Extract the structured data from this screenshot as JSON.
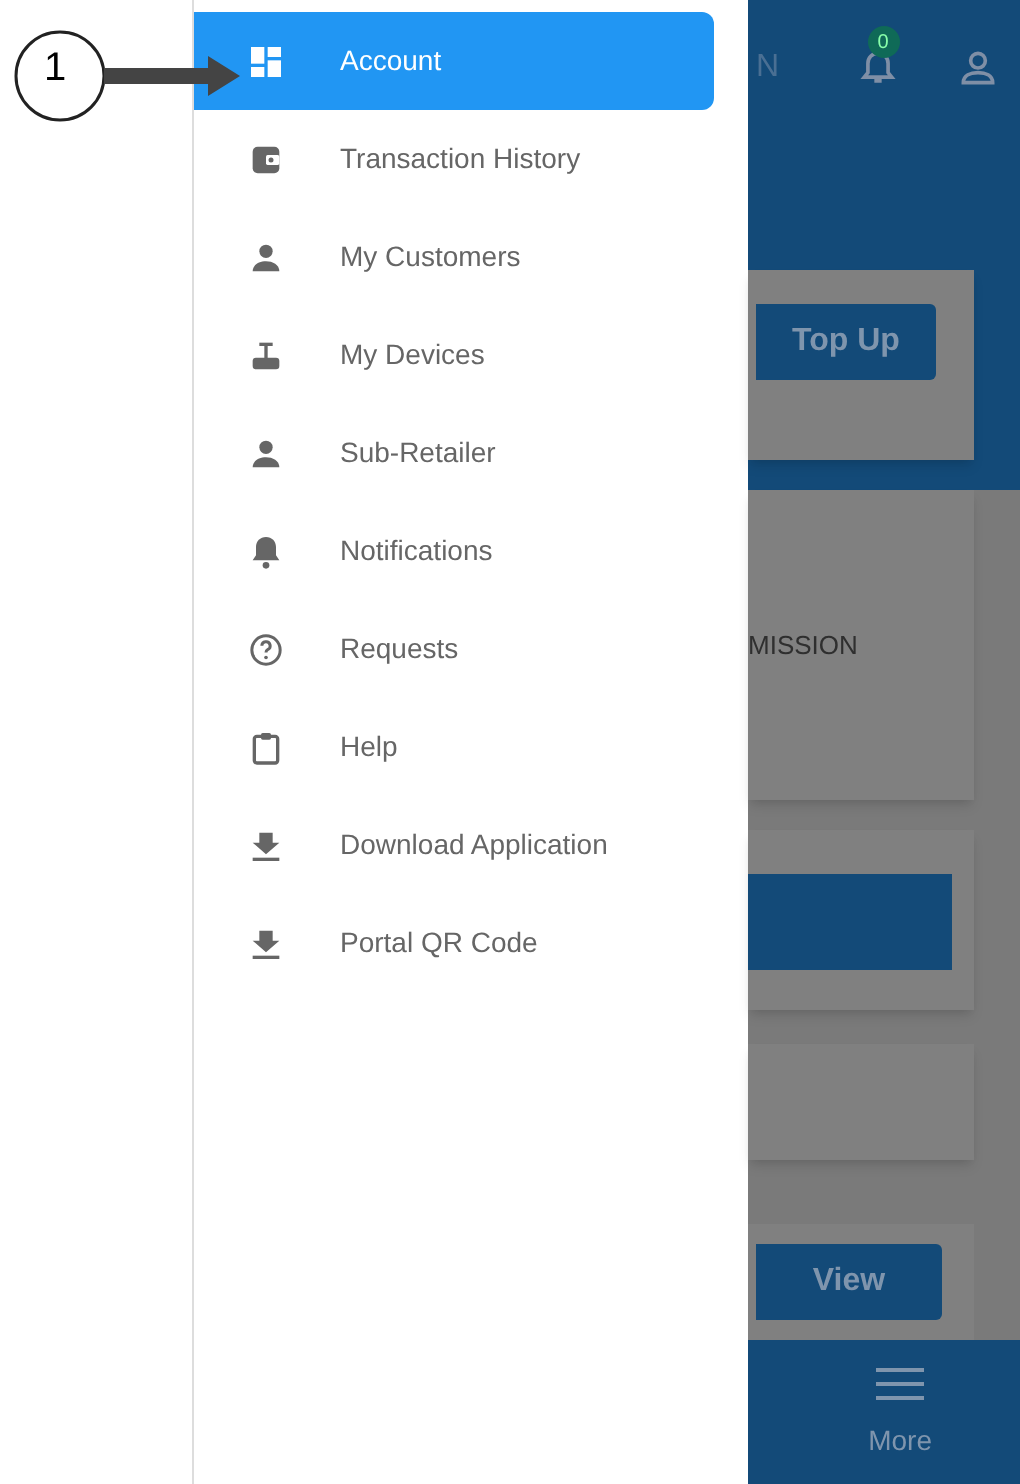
{
  "callout": {
    "number": "1"
  },
  "drawer": {
    "items": [
      {
        "label": "Account",
        "selected": true
      },
      {
        "label": "Transaction History",
        "selected": false
      },
      {
        "label": "My Customers",
        "selected": false
      },
      {
        "label": "My Devices",
        "selected": false
      },
      {
        "label": "Sub-Retailer",
        "selected": false
      },
      {
        "label": "Notifications",
        "selected": false
      },
      {
        "label": "Requests",
        "selected": false
      },
      {
        "label": "Help",
        "selected": false
      },
      {
        "label": "Download Application",
        "selected": false
      },
      {
        "label": "Portal QR Code",
        "selected": false
      }
    ]
  },
  "background": {
    "header_text": "N",
    "badge": "0",
    "top_up_button": "Top Up",
    "card_text": "MISSION",
    "view_button": "View",
    "nav_more": "More"
  }
}
